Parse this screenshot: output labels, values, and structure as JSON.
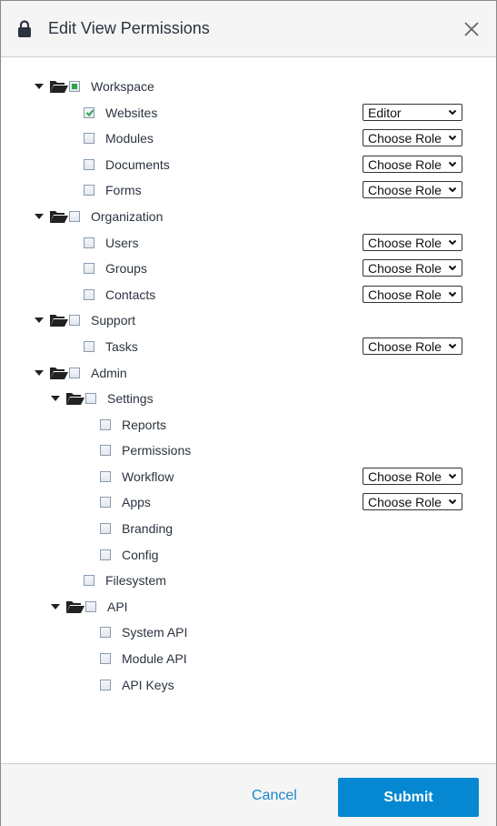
{
  "dialog": {
    "title": "Edit View Permissions",
    "icon": "lock-icon",
    "close_icon": "close-icon"
  },
  "tree": {
    "workspace": {
      "label": "Workspace",
      "state": "partial"
    },
    "websites": {
      "label": "Websites",
      "checked": true,
      "role": "Editor"
    },
    "modules": {
      "label": "Modules",
      "checked": false,
      "role": "Choose Role"
    },
    "documents": {
      "label": "Documents",
      "checked": false,
      "role": "Choose Role"
    },
    "forms": {
      "label": "Forms",
      "checked": false,
      "role": "Choose Role"
    },
    "organization": {
      "label": "Organization",
      "state": "unchecked"
    },
    "users": {
      "label": "Users",
      "checked": false,
      "role": "Choose Role"
    },
    "groups": {
      "label": "Groups",
      "checked": false,
      "role": "Choose Role"
    },
    "contacts": {
      "label": "Contacts",
      "checked": false,
      "role": "Choose Role"
    },
    "support": {
      "label": "Support",
      "state": "unchecked"
    },
    "tasks": {
      "label": "Tasks",
      "checked": false,
      "role": "Choose Role"
    },
    "admin": {
      "label": "Admin",
      "state": "unchecked"
    },
    "settings": {
      "label": "Settings",
      "state": "unchecked"
    },
    "reports": {
      "label": "Reports",
      "checked": false
    },
    "permissions": {
      "label": "Permissions",
      "checked": false
    },
    "workflow": {
      "label": "Workflow",
      "checked": false,
      "role": "Choose Role"
    },
    "apps": {
      "label": "Apps",
      "checked": false,
      "role": "Choose Role"
    },
    "branding": {
      "label": "Branding",
      "checked": false
    },
    "config": {
      "label": "Config",
      "checked": false
    },
    "filesystem": {
      "label": "Filesystem",
      "checked": false
    },
    "api": {
      "label": "API",
      "state": "unchecked"
    },
    "system_api": {
      "label": "System API",
      "checked": false
    },
    "module_api": {
      "label": "Module API",
      "checked": false
    },
    "api_keys": {
      "label": "API Keys",
      "checked": false
    }
  },
  "footer": {
    "cancel_label": "Cancel",
    "submit_label": "Submit"
  },
  "colors": {
    "primary": "#0588d1",
    "link": "#1d87c8",
    "check": "#2ea844"
  }
}
